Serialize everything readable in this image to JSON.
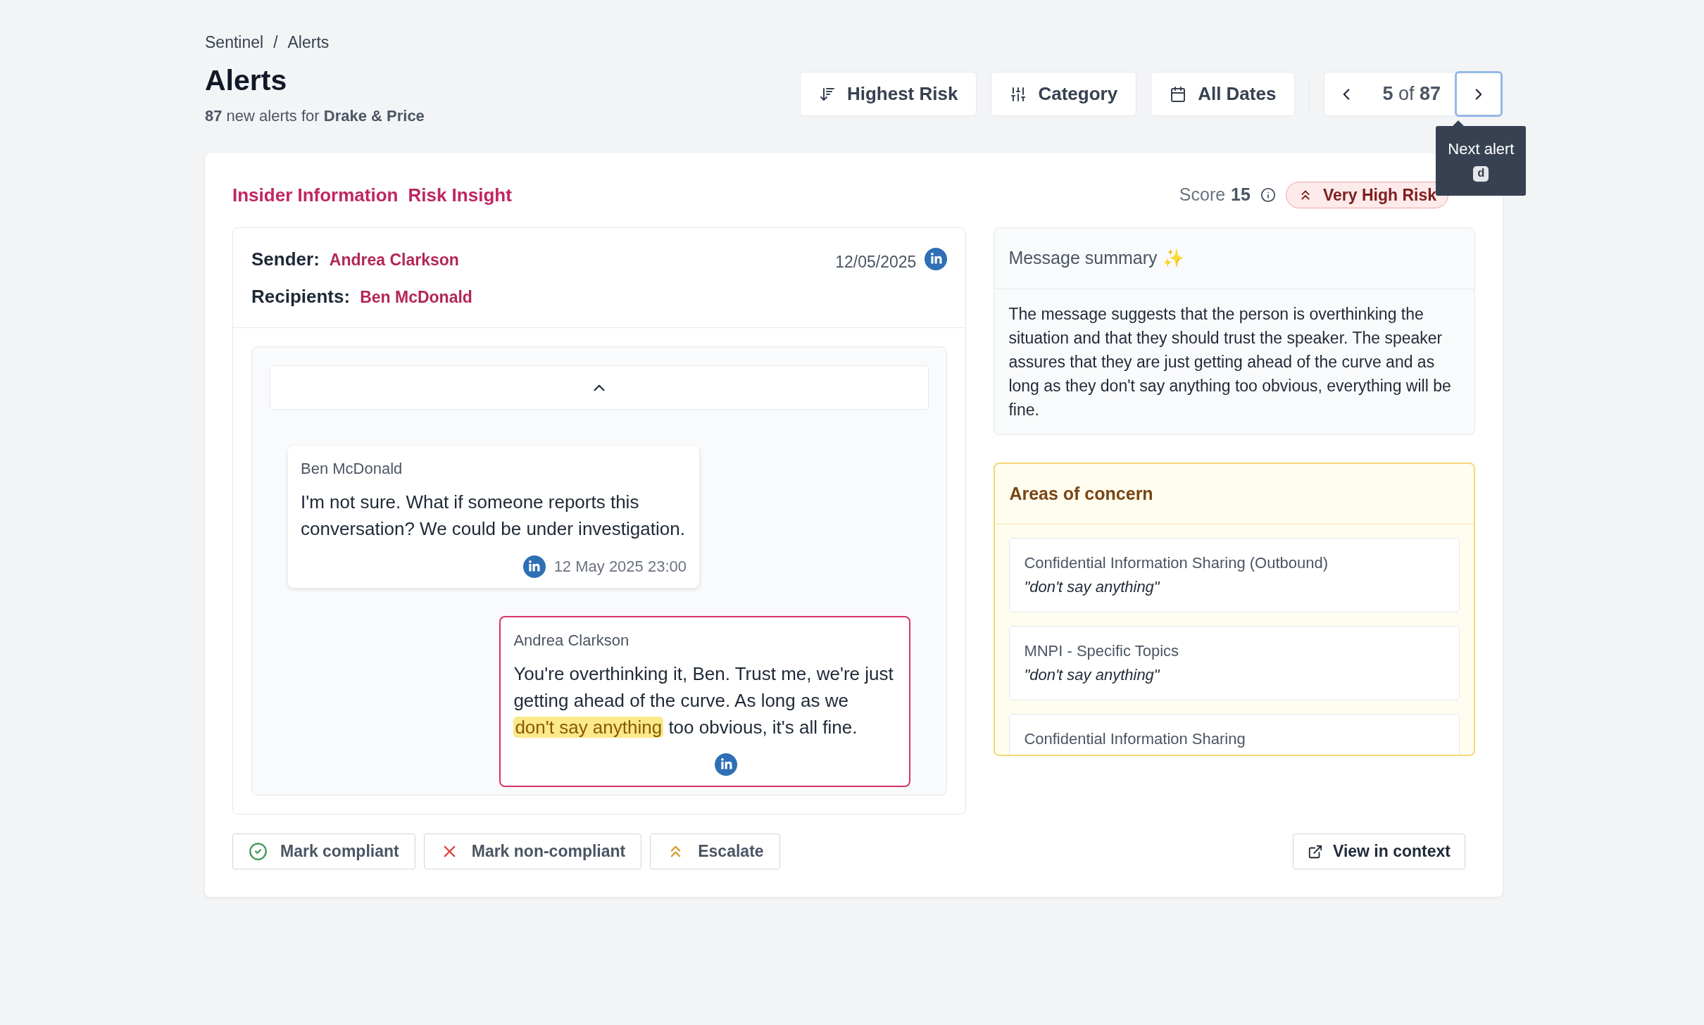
{
  "breadcrumb": {
    "items": [
      "Sentinel",
      "Alerts"
    ],
    "separator": "/"
  },
  "title": "Alerts",
  "subtitle": "**87** new alerts for **Drake & Price**",
  "filters": [
    {
      "label": "Highest Risk",
      "kind": "sort"
    },
    {
      "label": "Category",
      "kind": "category"
    },
    {
      "label": "All Dates",
      "kind": "date"
    }
  ],
  "pager": {
    "text": "**5** of **87**",
    "tooltip": "Next alert",
    "shortcut": "d"
  },
  "alert": {
    "type": "Insider Information",
    "subtype": "Risk Insight",
    "score_label": "Score",
    "score": "15",
    "risk": "Very High Risk"
  },
  "message": {
    "sender_label": "Sender:",
    "sender": "Andrea Clarkson",
    "recipients_label": "Recipients:",
    "recipients": "Ben McDonald",
    "date": "12/05/2025",
    "chat": [
      {
        "author": "Ben McDonald",
        "kind": "incoming",
        "flagged": false,
        "segments": [
          {
            "text": "I'm not sure. What if someone reports this conversation? We could be under investigation.",
            "highlight": false
          }
        ],
        "time": "12 May 2025 23:00"
      },
      {
        "author": "Andrea Clarkson",
        "kind": "outgoing",
        "flagged": true,
        "segments": [
          {
            "text": "You're overthinking it, Ben. Trust me, we're just getting ahead of the curve. As long as we ",
            "highlight": false
          },
          {
            "text": "don't say anything",
            "highlight": true
          },
          {
            "text": " too obvious, it's all fine.",
            "highlight": false
          }
        ]
      }
    ]
  },
  "summary": {
    "title": "Message summary ✨",
    "text": "The message suggests that the person is overthinking the situation and that they should trust the speaker. The speaker assures that they are just getting ahead of the curve and as long as they don't say anything too obvious, everything will be fine."
  },
  "concerns": {
    "title": "Areas of concern",
    "items": [
      {
        "name": "Confidential Information Sharing (Outbound)",
        "quote": "\"don't say anything\""
      },
      {
        "name": "MNPI - Specific Topics",
        "quote": "\"don't say anything\""
      },
      {
        "name": "Confidential Information Sharing"
      }
    ]
  },
  "actions": [
    {
      "label": "Mark compliant",
      "kind": "compliant"
    },
    {
      "label": "Mark non-compliant",
      "kind": "noncompliant"
    },
    {
      "label": "Escalate",
      "kind": "escalate"
    }
  ],
  "context_button": "View in context"
}
